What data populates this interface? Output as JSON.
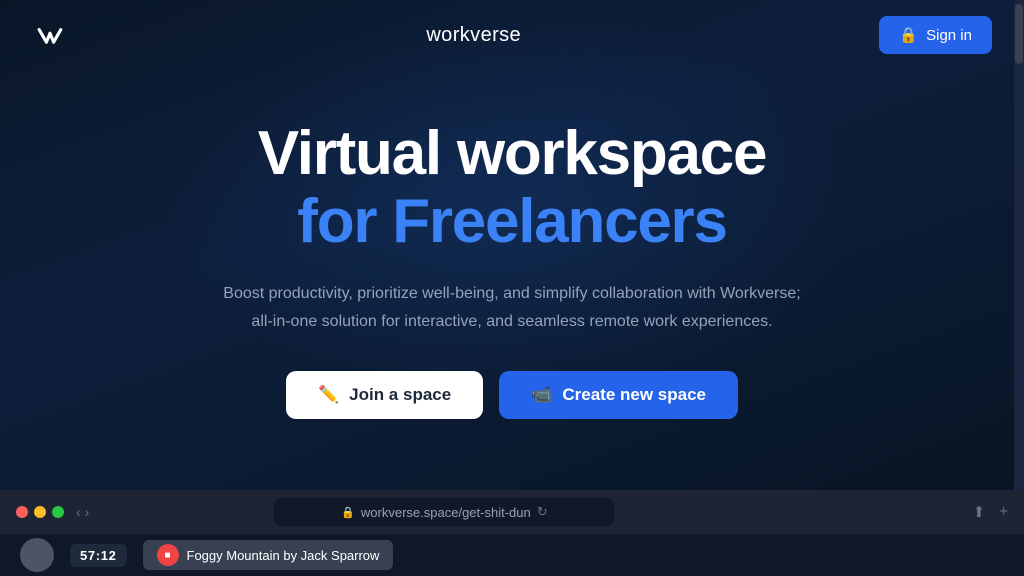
{
  "brand": {
    "name": "workverse",
    "logo_alt": "workverse logo"
  },
  "navbar": {
    "sign_in_label": "Sign in",
    "sign_in_icon": "lock-icon"
  },
  "hero": {
    "title_line1": "Virtual workspace",
    "title_line2": "for Freelancers",
    "subtitle": "Boost productivity, prioritize well-being, and simplify collaboration with Workverse; all-in-one solution for interactive, and seamless remote work experiences."
  },
  "cta": {
    "join_label": "Join a space",
    "join_icon": "pencil-icon",
    "create_label": "Create new space",
    "create_icon": "video-icon"
  },
  "browser_bar": {
    "url": "workverse.space/get-shit-dun",
    "lock_icon": "lock-icon",
    "refresh_icon": "refresh-icon",
    "share_icon": "share-icon",
    "add_icon": "add-icon"
  },
  "media_bar": {
    "time": "57:12",
    "track_name": "Foggy Mountain by Jack Sparrow"
  },
  "colors": {
    "accent_blue": "#2563eb",
    "text_blue": "#3b82f6",
    "bg_dark": "#0d1b2e",
    "white": "#ffffff"
  }
}
